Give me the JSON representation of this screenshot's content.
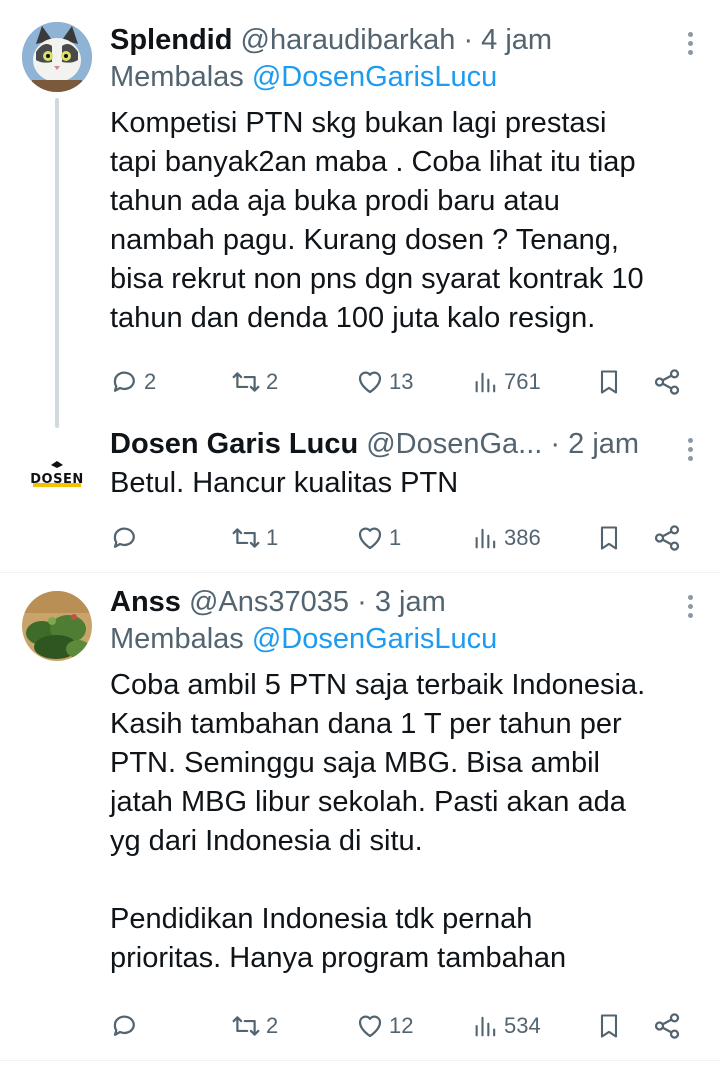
{
  "tweets": [
    {
      "name": "Splendid",
      "handle": "@haraudibarkah",
      "time": "· 4 jam",
      "reply_label": "Membalas ",
      "reply_mention": "@DosenGarisLucu",
      "text": "Kompetisi PTN skg bukan lagi prestasi\ntapi banyak2an maba . Coba lihat itu tiap\ntahun ada aja buka prodi baru atau\nnambah pagu. Kurang dosen ? Tenang,\nbisa rekrut non pns dgn syarat kontrak 10\ntahun dan denda 100 juta kalo resign.",
      "replies": "2",
      "retweets": "2",
      "likes": "13",
      "views": "761",
      "avatar": "cat-avatar"
    },
    {
      "name": "Dosen Garis Lucu",
      "handle": "@DosenGa...",
      "time": "· 2 jam",
      "text": "Betul. Hancur kualitas PTN",
      "replies": "",
      "retweets": "1",
      "likes": "1",
      "views": "386",
      "avatar_text": "DOSEN"
    },
    {
      "name": "Anss",
      "handle": "@Ans37035",
      "time": "· 3 jam",
      "reply_label": "Membalas ",
      "reply_mention": "@DosenGarisLucu",
      "text": "Coba ambil 5 PTN saja terbaik Indonesia.\nKasih tambahan dana 1 T per tahun per\nPTN. Seminggu saja MBG. Bisa ambil\njatah MBG libur sekolah. Pasti akan ada\nyg dari Indonesia di situ.\n\nPendidikan Indonesia tdk pernah\nprioritas. Hanya program tambahan",
      "replies": "",
      "retweets": "2",
      "likes": "12",
      "views": "534",
      "avatar": "plant-avatar"
    }
  ],
  "colors": {
    "text": "#0f1419",
    "secondary": "#536471",
    "link": "#1d9bf0",
    "thread_line": "#cfd9de"
  }
}
